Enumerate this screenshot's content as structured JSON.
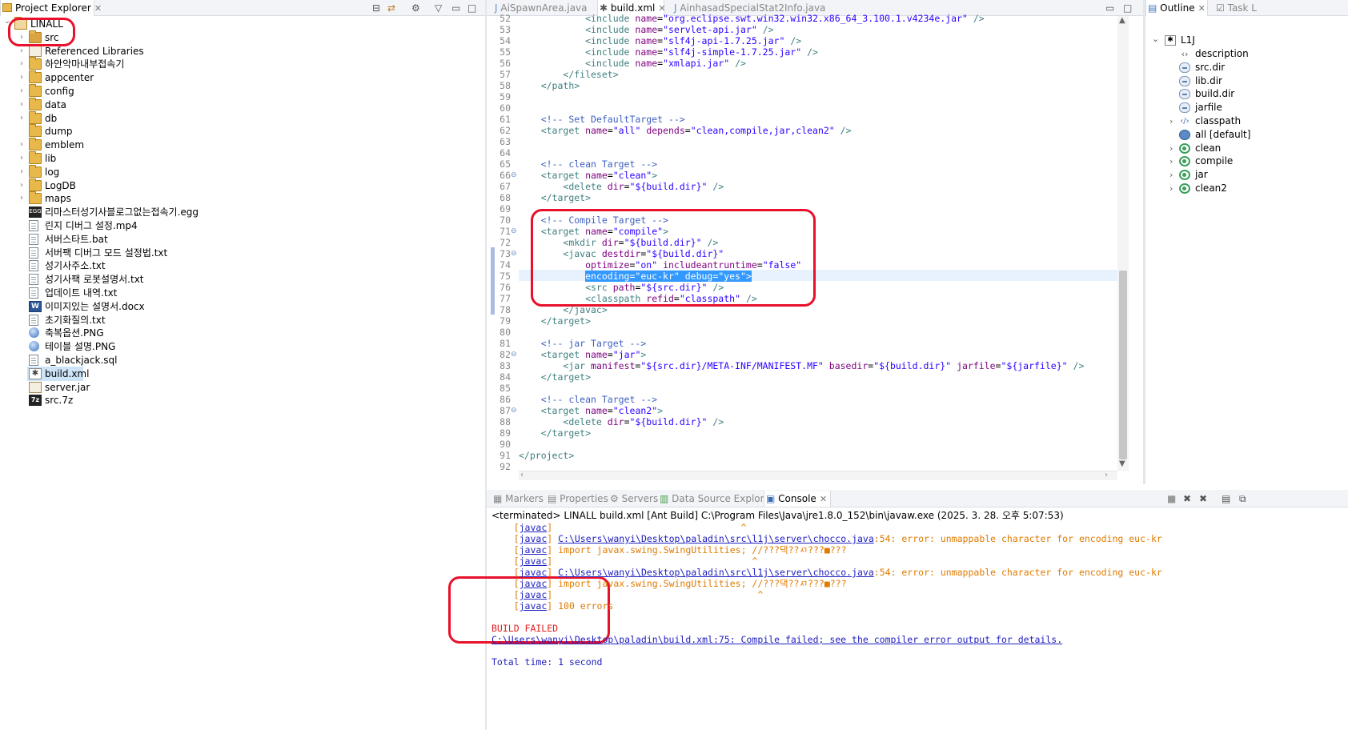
{
  "explorer": {
    "title": "Project Explorer",
    "items": [
      {
        "label": "LINALL",
        "type": "project",
        "expanded": true
      },
      {
        "label": "src",
        "type": "src"
      },
      {
        "label": "Referenced Libraries",
        "type": "lib"
      },
      {
        "label": "하안악마내부접속기",
        "type": "folder"
      },
      {
        "label": "appcenter",
        "type": "folder"
      },
      {
        "label": "config",
        "type": "folder"
      },
      {
        "label": "data",
        "type": "folder"
      },
      {
        "label": "db",
        "type": "folder"
      },
      {
        "label": "dump",
        "type": "folder"
      },
      {
        "label": "emblem",
        "type": "folder"
      },
      {
        "label": "lib",
        "type": "folder"
      },
      {
        "label": "log",
        "type": "folder"
      },
      {
        "label": "LogDB",
        "type": "folder"
      },
      {
        "label": "maps",
        "type": "folder"
      },
      {
        "label": "리마스터성기사블로그없는접속기.egg",
        "type": "egg"
      },
      {
        "label": "린지 디버그 설정.mp4",
        "type": "file"
      },
      {
        "label": "서버스타트.bat",
        "type": "file"
      },
      {
        "label": "서버팩 디버그 모드 설정법.txt",
        "type": "file"
      },
      {
        "label": "성기사주소.txt",
        "type": "file"
      },
      {
        "label": "성기사팩 로봇설명서.txt",
        "type": "file"
      },
      {
        "label": "업데이트 내역.txt",
        "type": "file"
      },
      {
        "label": "이미지있는 설명서.docx",
        "type": "word"
      },
      {
        "label": "초기화질의.txt",
        "type": "file"
      },
      {
        "label": "축복옵션.PNG",
        "type": "img"
      },
      {
        "label": "테이블 설명.PNG",
        "type": "img"
      },
      {
        "label": "a_blackjack.sql",
        "type": "file"
      },
      {
        "label": "build.xml",
        "type": "ant",
        "selected": true
      },
      {
        "label": "server.jar",
        "type": "jar"
      },
      {
        "label": "src.7z",
        "type": "zip"
      }
    ]
  },
  "editor": {
    "tabs": [
      "AiSpawnArea.java",
      "build.xml",
      "AinhasadSpecialStat2Info.java"
    ],
    "active_tab": "build.xml",
    "lines": [
      {
        "n": "52",
        "t": "            <include name=\"org.eclipse.swt.win32.win32.x86_64_3.100.1.v4234e.jar\" />"
      },
      {
        "n": "53",
        "t": "            <include name=\"servlet-api.jar\" />"
      },
      {
        "n": "54",
        "t": "            <include name=\"slf4j-api-1.7.25.jar\" />"
      },
      {
        "n": "55",
        "t": "            <include name=\"slf4j-simple-1.7.25.jar\" />"
      },
      {
        "n": "56",
        "t": "            <include name=\"xmlapi.jar\" />"
      },
      {
        "n": "57",
        "t": "        </fileset>"
      },
      {
        "n": "58",
        "t": "    </path>"
      },
      {
        "n": "59",
        "t": ""
      },
      {
        "n": "60",
        "t": ""
      },
      {
        "n": "61",
        "t": "    <!-- Set DefaultTarget -->"
      },
      {
        "n": "62",
        "t": "    <target name=\"all\" depends=\"clean,compile,jar,clean2\" />"
      },
      {
        "n": "63",
        "t": ""
      },
      {
        "n": "64",
        "t": ""
      },
      {
        "n": "65",
        "t": "    <!-- clean Target -->"
      },
      {
        "n": "66",
        "t": "    <target name=\"clean\">"
      },
      {
        "n": "67",
        "t": "        <delete dir=\"${build.dir}\" />"
      },
      {
        "n": "68",
        "t": "    </target>"
      },
      {
        "n": "69",
        "t": ""
      },
      {
        "n": "70",
        "t": "    <!-- Compile Target -->"
      },
      {
        "n": "71",
        "t": "    <target name=\"compile\">"
      },
      {
        "n": "72",
        "t": "        <mkdir dir=\"${build.dir}\" />"
      },
      {
        "n": "73",
        "t": "        <javac destdir=\"${build.dir}\""
      },
      {
        "n": "74",
        "t": "            optimize=\"on\" includeantruntime=\"false\""
      },
      {
        "n": "75",
        "t": "            encoding=\"euc-kr\" debug=\"yes\">"
      },
      {
        "n": "76",
        "t": "            <src path=\"${src.dir}\" />"
      },
      {
        "n": "77",
        "t": "            <classpath refid=\"classpath\" />"
      },
      {
        "n": "78",
        "t": "        </javac>"
      },
      {
        "n": "79",
        "t": "    </target>"
      },
      {
        "n": "80",
        "t": ""
      },
      {
        "n": "81",
        "t": "    <!-- jar Target -->"
      },
      {
        "n": "82",
        "t": "    <target name=\"jar\">"
      },
      {
        "n": "83",
        "t": "        <jar manifest=\"${src.dir}/META-INF/MANIFEST.MF\" basedir=\"${build.dir}\" jarfile=\"${jarfile}\" />"
      },
      {
        "n": "84",
        "t": "    </target>"
      },
      {
        "n": "85",
        "t": ""
      },
      {
        "n": "86",
        "t": "    <!-- clean Target -->"
      },
      {
        "n": "87",
        "t": "    <target name=\"clean2\">"
      },
      {
        "n": "88",
        "t": "        <delete dir=\"${build.dir}\" />"
      },
      {
        "n": "89",
        "t": "    </target>"
      },
      {
        "n": "90",
        "t": ""
      },
      {
        "n": "91",
        "t": "</project>"
      },
      {
        "n": "92",
        "t": ""
      }
    ]
  },
  "outline": {
    "tabs": [
      "Outline",
      "Task L"
    ],
    "root": "L1J",
    "items": [
      {
        "label": "description",
        "icon": "attr",
        "chev": false
      },
      {
        "label": "src.dir",
        "icon": "prop",
        "chev": false
      },
      {
        "label": "lib.dir",
        "icon": "prop",
        "chev": false
      },
      {
        "label": "build.dir",
        "icon": "prop",
        "chev": false
      },
      {
        "label": "jarfile",
        "icon": "prop",
        "chev": false
      },
      {
        "label": "classpath",
        "icon": "path",
        "chev": true
      },
      {
        "label": "all [default]",
        "icon": "default",
        "chev": false
      },
      {
        "label": "clean",
        "icon": "target",
        "chev": true
      },
      {
        "label": "compile",
        "icon": "target",
        "chev": true
      },
      {
        "label": "jar",
        "icon": "target",
        "chev": true
      },
      {
        "label": "clean2",
        "icon": "target",
        "chev": true
      }
    ]
  },
  "bottom": {
    "tabs": [
      "Markers",
      "Properties",
      "Servers",
      "Data Source Explorer",
      "Console"
    ],
    "active_tab": "Console",
    "status": "<terminated> LINALL build.xml [Ant Build] C:\\Program Files\\Java\\jre1.8.0_152\\bin\\javaw.exe (2025. 3. 28. 오후 5:07:53)",
    "lines": [
      {
        "kind": "javac",
        "prefix": "    [javac] ",
        "text": "                                 ^"
      },
      {
        "kind": "javac-link",
        "prefix": "    [javac] ",
        "link": "C:\\Users\\wanyi\\Desktop\\paladin\\src\\l1j\\server\\chocco.java",
        "rest": ":54: error: unmappable character for encoding euc-kr"
      },
      {
        "kind": "javac",
        "prefix": "    [javac] ",
        "text": "import javax.swing.SwingUtilities; //???댁??ㅺ???■???"
      },
      {
        "kind": "javac",
        "prefix": "    [javac] ",
        "text": "                                   ^"
      },
      {
        "kind": "javac-link",
        "prefix": "    [javac] ",
        "link": "C:\\Users\\wanyi\\Desktop\\paladin\\src\\l1j\\server\\chocco.java",
        "rest": ":54: error: unmappable character for encoding euc-kr"
      },
      {
        "kind": "javac",
        "prefix": "    [javac] ",
        "text": "import javax.swing.SwingUtilities; //???댁??ㅺ???■???"
      },
      {
        "kind": "javac",
        "prefix": "    [javac] ",
        "text": "                                    ^"
      },
      {
        "kind": "javac",
        "prefix": "    [javac] ",
        "text": "100 errors"
      },
      {
        "kind": "blank",
        "text": ""
      },
      {
        "kind": "error",
        "text": "BUILD FAILED"
      },
      {
        "kind": "link",
        "text": "C:\\Users\\wanyi\\Desktop\\paladin\\build.xml:75: Compile failed; see the compiler error output for details."
      },
      {
        "kind": "blank",
        "text": ""
      },
      {
        "kind": "plain",
        "text": "Total time: 1 second"
      }
    ]
  },
  "colors": {
    "annotation_red": "#e8102a",
    "selection": "#3399ff",
    "console_orange": "#e07b00",
    "link_blue": "#2020c0"
  }
}
